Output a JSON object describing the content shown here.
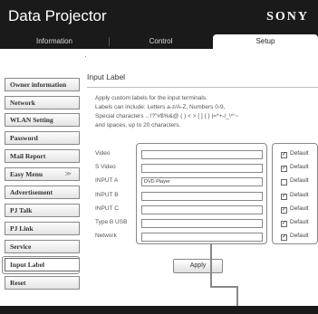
{
  "header": {
    "title": "Data Projector",
    "brand": "SONY"
  },
  "tabs": [
    {
      "label": "Information"
    },
    {
      "label": "Control"
    },
    {
      "label": "Setup"
    }
  ],
  "subnav": {
    "dot": "·"
  },
  "sidebar": {
    "items": [
      {
        "label": "Owner information"
      },
      {
        "label": "Network"
      },
      {
        "label": "WLAN Setting"
      },
      {
        "label": "Password"
      },
      {
        "label": "Mail Report"
      },
      {
        "label": "Easy Menu",
        "caret": "≫"
      },
      {
        "label": "Advertisement"
      },
      {
        "label": "PJ Talk"
      },
      {
        "label": "PJ Link"
      },
      {
        "label": "Service"
      },
      {
        "label": "Input Label"
      },
      {
        "label": "Reset"
      }
    ]
  },
  "main": {
    "title": "Input Label",
    "description": [
      "Apply custom labels for the input terminals.",
      "Labels can include: Letters a-z/A-Z, Numbers 0-9,",
      "Special characters ..:!?\"#$%&@ ( ) < > [ ] { } |=*+-/_\\^'~",
      "and spaces, up to 20 characters."
    ],
    "rows": [
      {
        "label": "Video",
        "value": "",
        "checked": true,
        "check_label": "Default"
      },
      {
        "label": "S Video",
        "value": "",
        "checked": true,
        "check_label": "Default"
      },
      {
        "label": "INPUT A",
        "value": "DVD Player",
        "checked": false,
        "check_label": "Default"
      },
      {
        "label": "INPUT B",
        "value": "",
        "checked": true,
        "check_label": "Default"
      },
      {
        "label": "INPUT C",
        "value": "",
        "checked": true,
        "check_label": "Default"
      },
      {
        "label": "Type B USB",
        "value": "",
        "checked": true,
        "check_label": "Default"
      },
      {
        "label": "Network",
        "value": "",
        "checked": true,
        "check_label": "Default"
      }
    ],
    "apply_label": "Apply",
    "check_mark": "✓"
  }
}
